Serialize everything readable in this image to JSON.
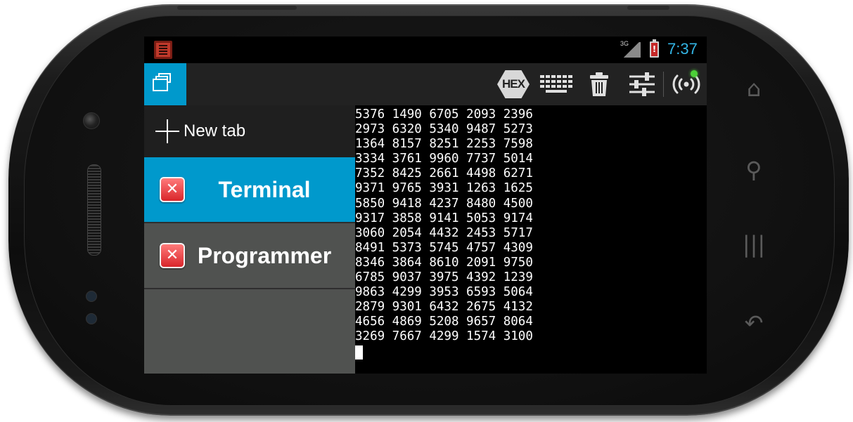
{
  "statusbar": {
    "network_type": "3G",
    "battery_alert": "!",
    "time": "7:37"
  },
  "actionbar": {
    "hex_label": "HEX",
    "icons": [
      "tabs-icon",
      "hex-icon",
      "keyboard-icon",
      "trash-icon",
      "settings-sliders-icon",
      "broadcast-icon"
    ]
  },
  "drawer": {
    "new_tab_label": "New tab",
    "tabs": [
      {
        "label": "Terminal",
        "active": true,
        "close": "✕"
      },
      {
        "label": "Programmer",
        "active": false,
        "close": "✕"
      }
    ]
  },
  "terminal": {
    "lines": [
      "5376 1490 6705 2093 2396",
      "2973 6320 5340 9487 5273",
      "1364 8157 8251 2253 7598",
      "3334 3761 9960 7737 5014",
      "7352 8425 2661 4498 6271",
      "9371 9765 3931 1263 1625",
      "5850 9418 4237 8480 4500",
      "9317 3858 9141 5053 9174",
      "3060 2054 4432 2453 5717",
      "8491 5373 5745 4757 4309",
      "8346 3864 8610 2091 9750",
      "6785 9037 3975 4392 1239",
      "9863 4299 3953 6593 5064",
      "2879 9301 6432 2675 4132",
      "4656 4869 5208 9657 8064",
      "3269 7667 4299 1574 3100"
    ]
  },
  "colors": {
    "accent": "#0099cc",
    "clock": "#33b5e5",
    "connected_indicator": "#4cd137"
  }
}
